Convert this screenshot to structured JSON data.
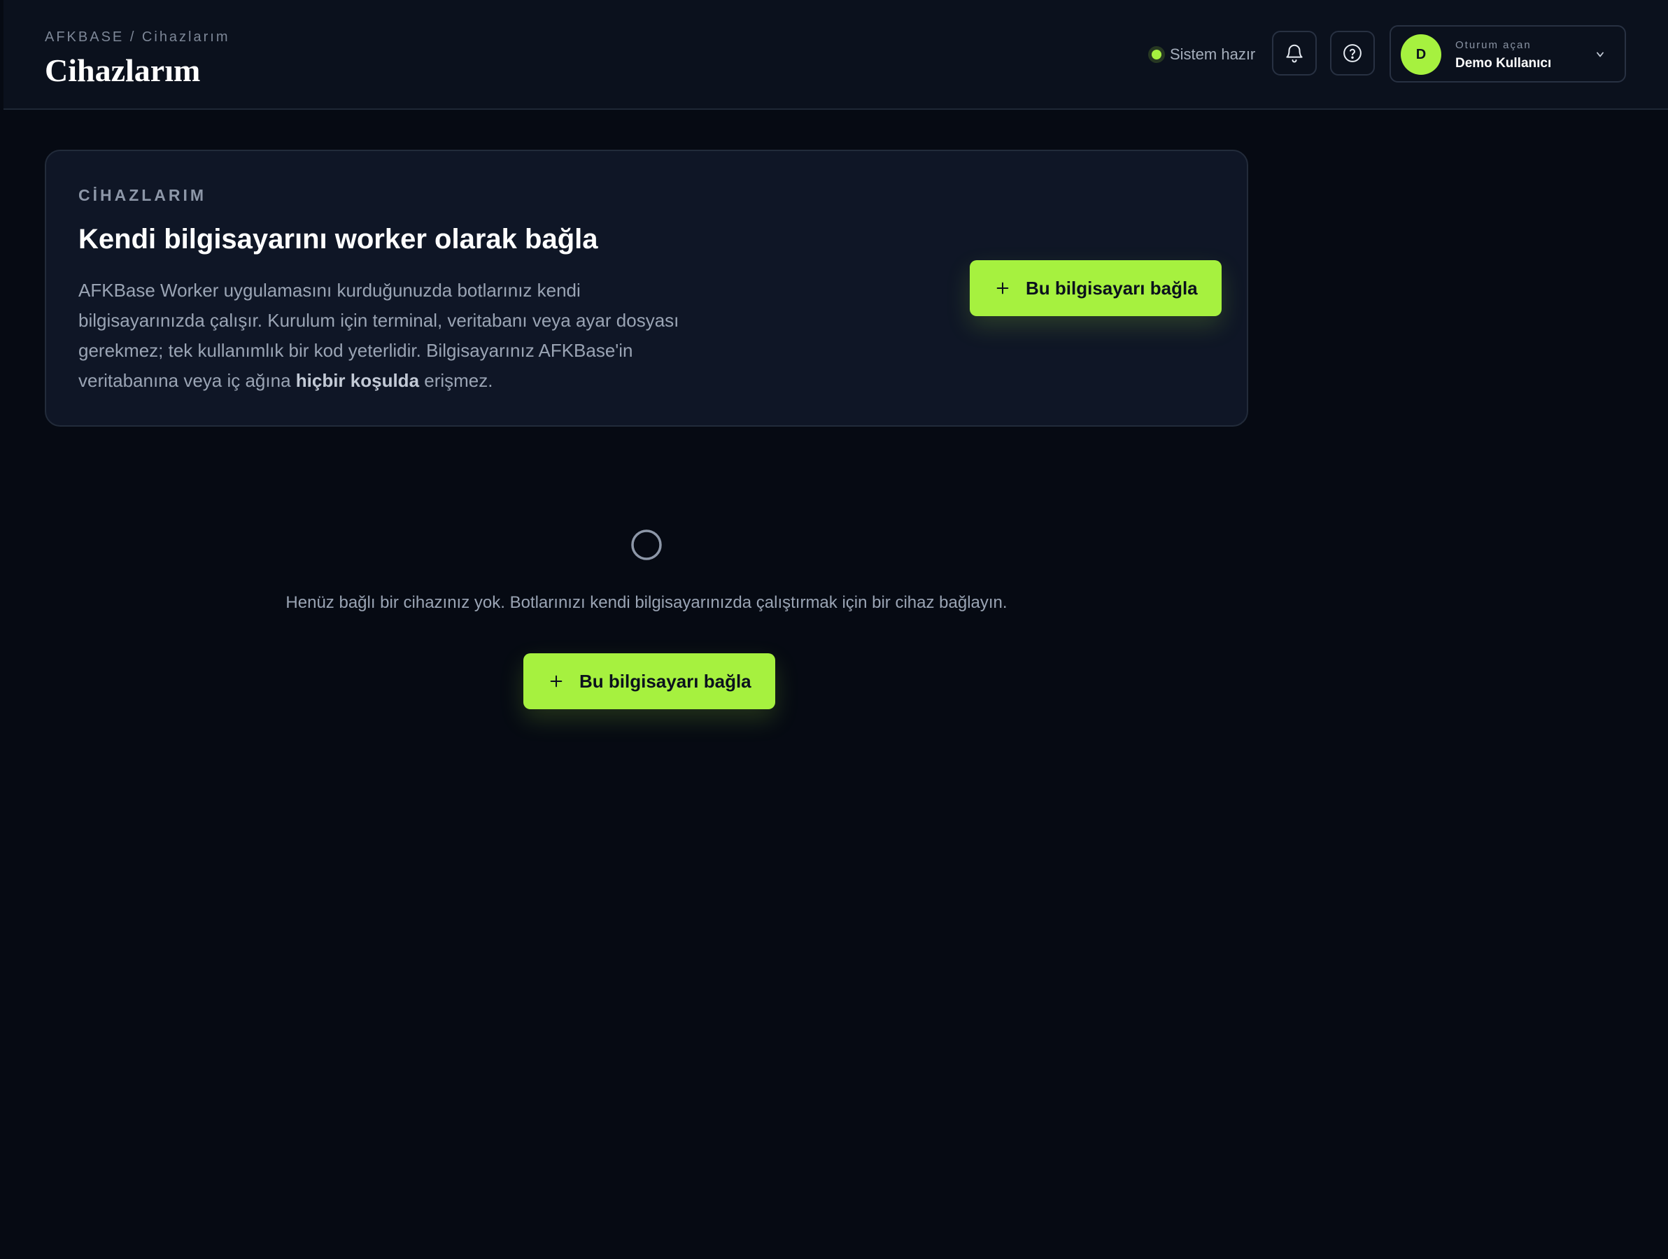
{
  "header": {
    "breadcrumb": "AFKBASE / Cihazlarım",
    "title": "Cihazlarım",
    "status_text": "Sistem hazır",
    "icons": {
      "status": "status-dot-icon",
      "notifications": "bell-icon",
      "help": "question-circle-icon",
      "menu": "chevron-down-icon"
    },
    "user": {
      "avatar_initial": "D",
      "caption": "Oturum açan",
      "name": "Demo Kullanıcı"
    }
  },
  "intro_card": {
    "eyebrow": "CİHAZLARIM",
    "title": "Kendi bilgisayarını worker olarak bağla",
    "description_prefix": "AFKBase Worker uygulamasını kurduğunuzda botlarınız kendi bilgisayarınızda çalışır. Kurulum için terminal, veritabanı veya ayar dosyası gerekmez; tek kullanımlık bir kod yeterlidir. Bilgisayarınız AFKBase'in veritabanına veya iç ağına ",
    "description_emphasis": "hiçbir koşulda",
    "description_suffix": " erişmez.",
    "button_label": "Bu bilgisayarı bağla",
    "button_icon": "plus-icon"
  },
  "empty_state": {
    "icon": "empty-circle-icon",
    "message": "Henüz bağlı bir cihazınız yok. Botlarınızı kendi bilgisayarınızda çalıştırmak için bir cihaz bağlayın.",
    "button_label": "Bu bilgisayarı bağla",
    "button_icon": "plus-icon"
  },
  "colors": {
    "accent": "#a6f13f",
    "background": "#060a13",
    "header_background": "#0b111d",
    "card_background": "#0f1626",
    "muted_text": "#9aa4b4"
  }
}
